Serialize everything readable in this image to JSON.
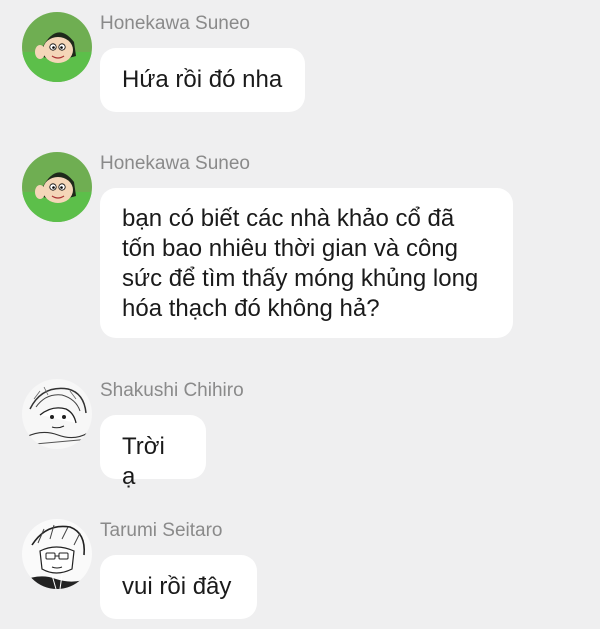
{
  "messages": [
    {
      "sender": "Honekawa Suneo",
      "avatar_icon": "suneo-avatar-icon",
      "lines": [
        "Hứa rồi đó nha"
      ]
    },
    {
      "sender": "Honekawa Suneo",
      "avatar_icon": "suneo-avatar-icon",
      "lines": [
        "bạn có biết các nhà khảo cổ đã",
        "tốn bao nhiêu thời gian và công",
        "sức để tìm thấy móng khủng long",
        "hóa thạch đó không hả?"
      ]
    },
    {
      "sender": "Shakushi Chihiro",
      "avatar_icon": "manga-sketch-avatar-icon",
      "lines": [
        "Trời ạ"
      ]
    },
    {
      "sender": "Tarumi Seitaro",
      "avatar_icon": "manga-sketch-avatar-icon",
      "lines": [
        "vui rồi đây"
      ]
    }
  ],
  "colors": {
    "background": "#efeff0",
    "bubble": "#ffffff",
    "sender_name": "#8a8a8a",
    "message_text": "#1a1a1a",
    "suneo_shirt": "#5cbf4a"
  }
}
